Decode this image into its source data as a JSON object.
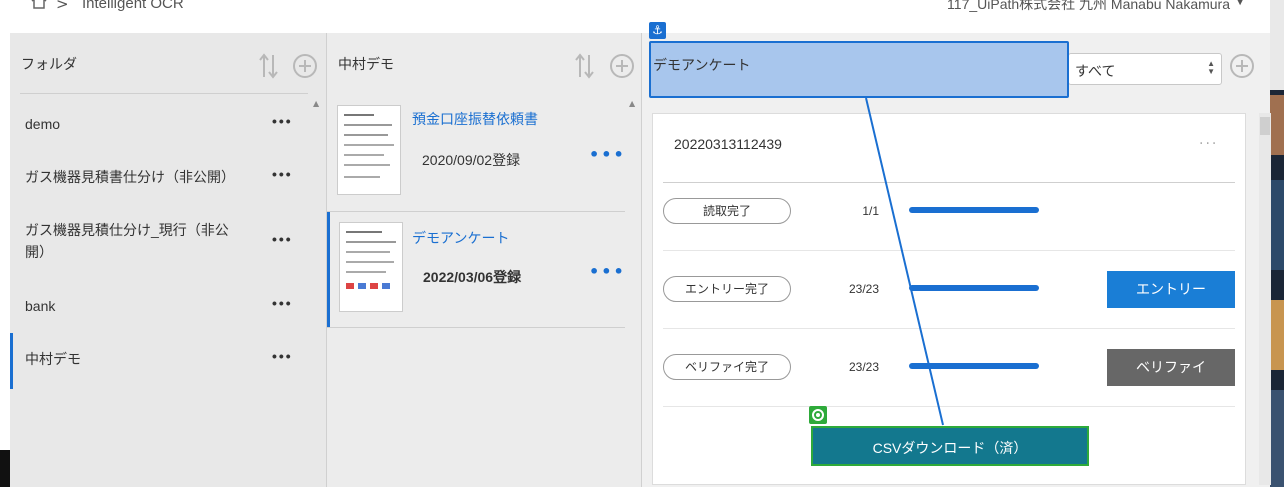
{
  "topbar": {
    "separator": ">",
    "title": "Intelligent OCR",
    "user": "117_UiPath株式会社 九州 Manabu Nakamura"
  },
  "folders": {
    "title": "フォルダ",
    "items": [
      {
        "label": "demo"
      },
      {
        "label": "ガス機器見積書仕分け（非公開）"
      },
      {
        "label": "ガス機器見積仕分け_現行（非公開）"
      },
      {
        "label": "bank"
      },
      {
        "label": "中村デモ"
      }
    ],
    "more": "•••"
  },
  "documents": {
    "title": "中村デモ",
    "items": [
      {
        "title": "預金口座振替依頼書",
        "date": "2020/09/02登録"
      },
      {
        "title": "デモアンケート",
        "date": "2022/03/06登録"
      }
    ],
    "more": "•••"
  },
  "detail": {
    "anchor_title": "デモアンケート",
    "anchor_badge": "⚓",
    "filter": {
      "selected": "すべて"
    },
    "card": {
      "id": "20220313112439",
      "more": "···",
      "rows": [
        {
          "status": "読取完了",
          "count": "1/1",
          "progress": 1.0
        },
        {
          "status": "エントリー完了",
          "count": "23/23",
          "progress": 1.0,
          "button": "エントリー"
        },
        {
          "status": "ベリファイ完了",
          "count": "23/23",
          "progress": 1.0,
          "button": "ベリファイ"
        }
      ],
      "csv_button": "CSVダウンロード（済）"
    }
  },
  "colors": {
    "accent": "#1a6fd1",
    "entry_button": "#1a7ed6",
    "verify_button": "#676767",
    "csv_button": "#13788e",
    "target_green": "#2eaa3a"
  }
}
